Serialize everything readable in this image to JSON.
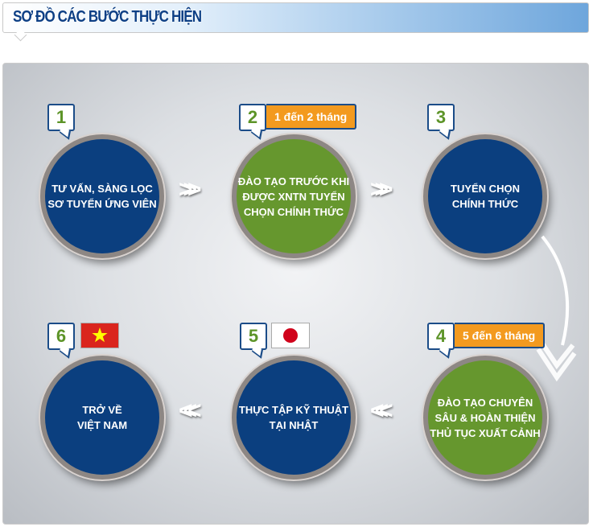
{
  "header": {
    "title": "SƠ ĐỒ CÁC BƯỚC THỰC HIỆN"
  },
  "steps": [
    {
      "number": "1",
      "text": "TƯ VẤN, SÀNG LỌC\nSƠ TUYỂN ỨNG VIÊN",
      "color": "#0b3f7f"
    },
    {
      "number": "2",
      "text": "ĐÀO TẠO TRƯỚC KHI\nĐƯỢC XNTN TUYỂN\nCHỌN CHÍNH THỨC",
      "duration": "1 đến 2 tháng",
      "color": "#66972e"
    },
    {
      "number": "3",
      "text": "TUYỂN CHỌN\nCHÍNH THỨC",
      "color": "#0b3f7f"
    },
    {
      "number": "4",
      "text": "ĐÀO TẠO CHUYÊN\nSÂU & HOÀN THIỆN\nTHỦ TỤC XUẤT CẢNH",
      "duration": "5 đến 6 tháng",
      "color": "#66972e"
    },
    {
      "number": "5",
      "text": "THỰC TẬP KỸ THUẬT\nTẠI NHẬT",
      "flag": "japan",
      "color": "#0b3f7f"
    },
    {
      "number": "6",
      "text": "TRỞ VỀ\nVIỆT NAM",
      "flag": "vietnam",
      "color": "#0b3f7f"
    }
  ]
}
